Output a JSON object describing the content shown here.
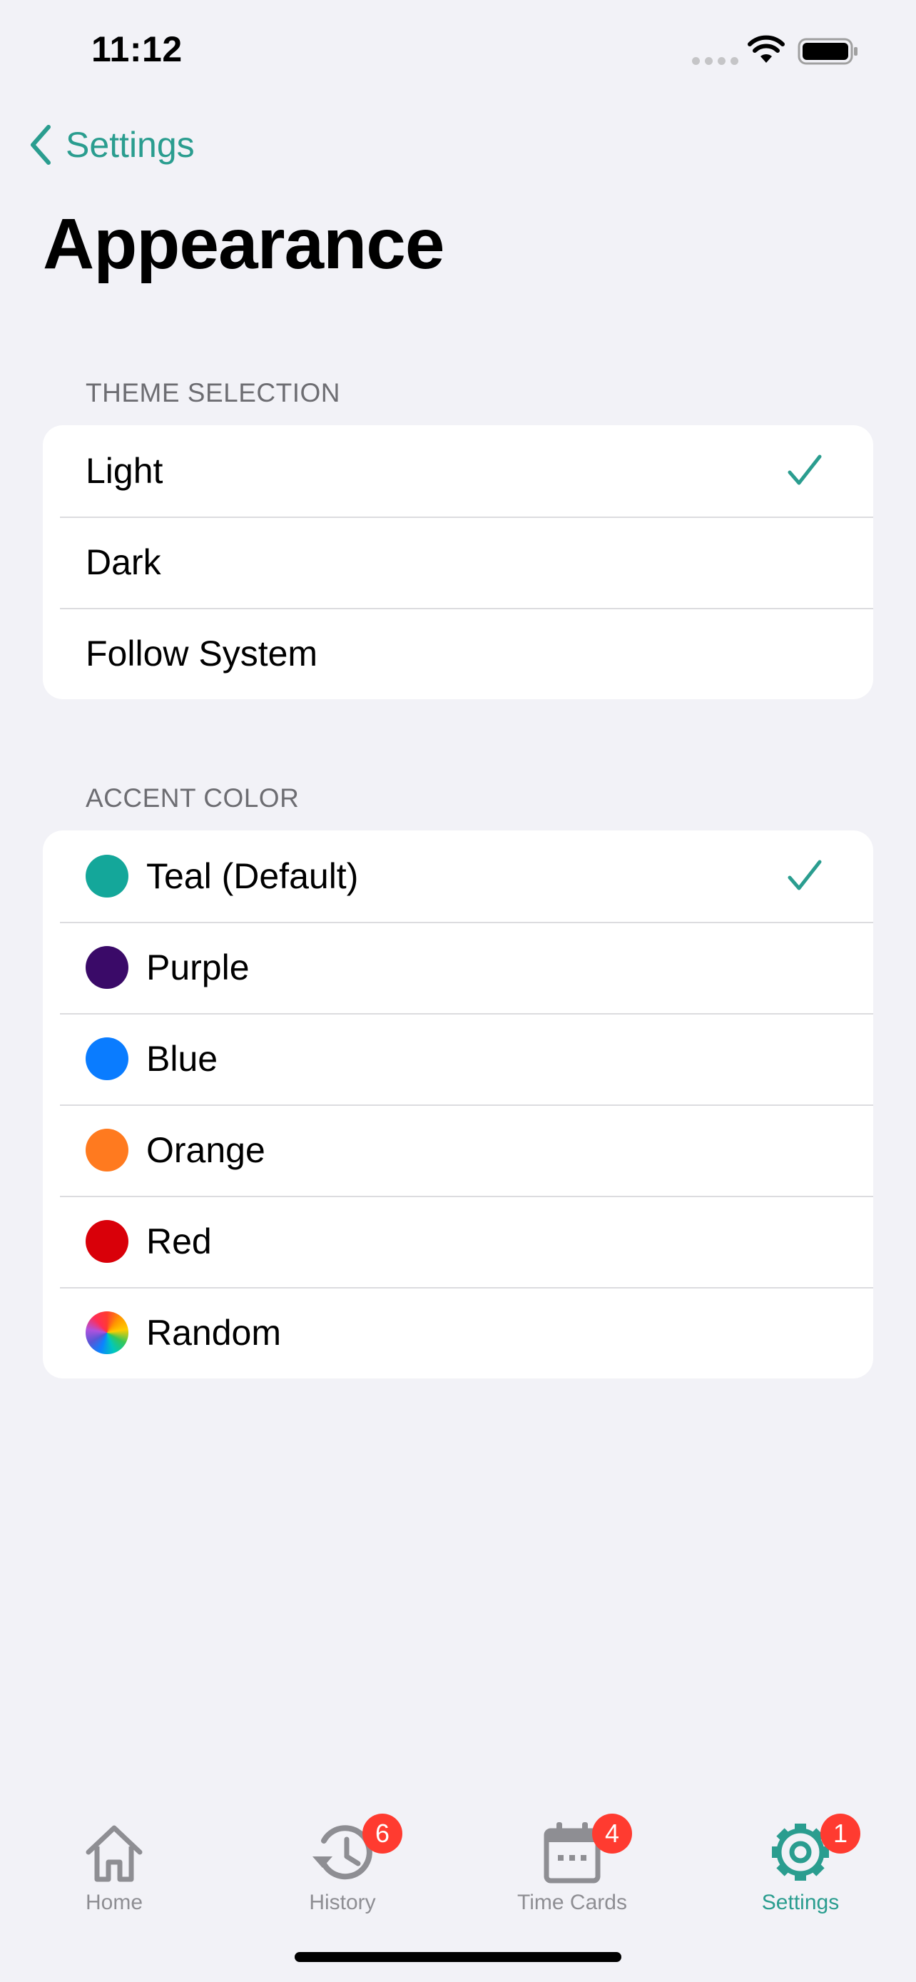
{
  "status_bar": {
    "time": "11:12"
  },
  "nav": {
    "back_label": "Settings",
    "title": "Appearance"
  },
  "theme_section": {
    "header": "THEME SELECTION",
    "options": [
      {
        "label": "Light",
        "selected": true
      },
      {
        "label": "Dark",
        "selected": false
      },
      {
        "label": "Follow System",
        "selected": false
      }
    ]
  },
  "accent_section": {
    "header": "ACCENT COLOR",
    "options": [
      {
        "label": "Teal (Default)",
        "color": "#14A79A",
        "selected": true
      },
      {
        "label": "Purple",
        "color": "#3A0A68",
        "selected": false
      },
      {
        "label": "Blue",
        "color": "#0A7CFF",
        "selected": false
      },
      {
        "label": "Orange",
        "color": "#FF7A1F",
        "selected": false
      },
      {
        "label": "Red",
        "color": "#D90009",
        "selected": false
      },
      {
        "label": "Random",
        "color": "rainbow",
        "selected": false
      }
    ]
  },
  "tab_bar": {
    "tabs": [
      {
        "label": "Home",
        "icon": "house-icon",
        "badge": ""
      },
      {
        "label": "History",
        "icon": "clock-history-icon",
        "badge": "6"
      },
      {
        "label": "Time Cards",
        "icon": "calendar-icon",
        "badge": "4"
      },
      {
        "label": "Settings",
        "icon": "gear-icon",
        "badge": "1"
      }
    ],
    "active": "Settings"
  },
  "colors": {
    "accent": "#2A9D8F",
    "badge": "#FF3B30",
    "inactive": "#8E8E93",
    "background": "#F2F2F7"
  }
}
